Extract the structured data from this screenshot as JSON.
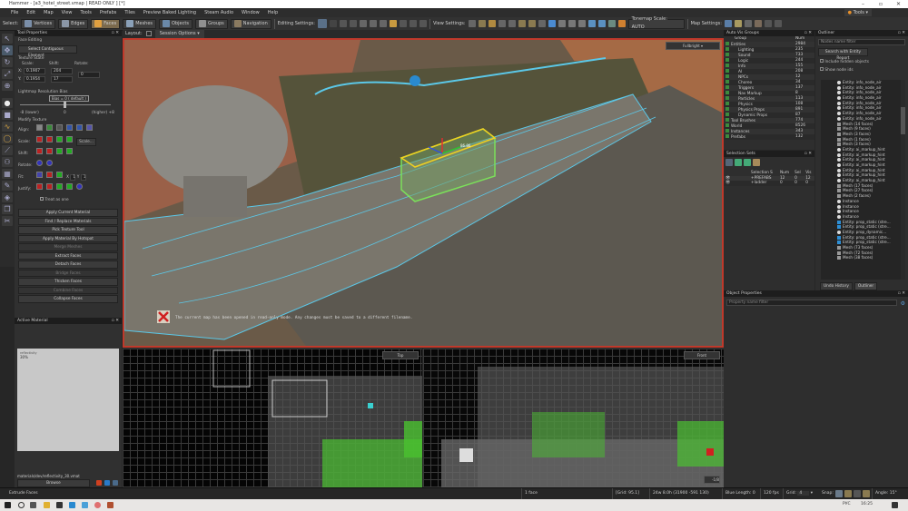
{
  "window": {
    "title": "Hammer - [a3_hotel_street.vmap | READ ONLY ] [*]"
  },
  "menu": [
    "File",
    "Edit",
    "Map",
    "View",
    "Tools",
    "Prefabs",
    "Tiles",
    "Preview Baked Lighting",
    "Steam Audio",
    "Window",
    "Help"
  ],
  "toolbar": {
    "select_label": "Select:",
    "modes": [
      "Vertices",
      "Edges",
      "Faces",
      "Meshes",
      "Objects",
      "Groups",
      "Navigation"
    ],
    "active_mode": "Faces",
    "editing_settings": "Editing Settings:",
    "view_settings": "View Settings:",
    "tonemap": "Tonemap Scale: AUTO",
    "map_settings": "Map Settings:",
    "tools": "Tools"
  },
  "tool_properties": {
    "title": "Tool Properties",
    "section": "Face Editing",
    "select_contiguous": "Select Contiguous Element",
    "texture_state": "Texture State",
    "scale_label": "Scale:",
    "shift_label": "Shift:",
    "rotate_label": "Rotate:",
    "x_label": "X:",
    "y_label": "Y:",
    "scale_x": "0.1907",
    "scale_y": "0.1954",
    "shift_x": "204",
    "shift_y": "17",
    "rotate": "0",
    "lightmap_bias": "Lightmap Resolution Bias",
    "bias_value": "Bias = 0 ( default )",
    "bias_low": "-8 (lower)",
    "bias_mid": "0",
    "bias_high": "(higher) +8",
    "modify_texture": "Modify Texture",
    "align": "Align:",
    "scale": "Scale:",
    "shift": "Shift:",
    "rotate_row": "Rotate:",
    "fit": "Fit:",
    "justify": "Justify:",
    "scale_btn": "Scale...",
    "fit_x": "X",
    "fit_x_val": "1",
    "fit_y": "Y",
    "fit_y_val": "1",
    "treat_as_one": "Treat as one",
    "buttons": [
      {
        "label": "Apply Current Material",
        "enabled": true
      },
      {
        "label": "Find / Replace Materials",
        "enabled": true
      },
      {
        "label": "Pick Texture Tool",
        "enabled": true
      },
      {
        "label": "Apply Material By Hotspot",
        "enabled": true
      },
      {
        "label": "Merge Meshes",
        "enabled": false
      },
      {
        "label": "Extract Faces",
        "enabled": true
      },
      {
        "label": "Detach Faces",
        "enabled": true
      },
      {
        "label": "Bridge Faces",
        "enabled": false
      },
      {
        "label": "Thicken Faces",
        "enabled": true
      },
      {
        "label": "Combine Faces",
        "enabled": false
      },
      {
        "label": "Collapse Faces",
        "enabled": true
      }
    ]
  },
  "active_material": {
    "title": "Active Material",
    "preview_caption": "reflectivity",
    "preview_value": "30%",
    "path": "materials/dev/reflectivity_30.vmat",
    "browse": "Browse"
  },
  "viewport": {
    "layout": "Layout:",
    "session_options": "Session Options",
    "view_3d": "Fullbright",
    "selection_label": "86.86",
    "readonly_msg": "The current map has been opened in read-only mode. Any changes must be saved to a different filename.",
    "view_top": "Top",
    "view_front": "Front",
    "front_corner": "-1/8"
  },
  "vis_groups": {
    "title": "Auto Vis Groups",
    "col_group": "Group",
    "col_num": "Num",
    "rows": [
      {
        "name": "Entities",
        "num": "2984",
        "indent": 0,
        "expand": "-"
      },
      {
        "name": "Lighting",
        "num": "235",
        "indent": 1
      },
      {
        "name": "Sound",
        "num": "733",
        "indent": 1
      },
      {
        "name": "Logic",
        "num": "244",
        "indent": 1
      },
      {
        "name": "Info",
        "num": "155",
        "indent": 1
      },
      {
        "name": "AI",
        "num": "208",
        "indent": 1
      },
      {
        "name": "NPCs",
        "num": "12",
        "indent": 1
      },
      {
        "name": "Choreo",
        "num": "34",
        "indent": 1
      },
      {
        "name": "Triggers",
        "num": "137",
        "indent": 1
      },
      {
        "name": "Nav Markup",
        "num": "8",
        "indent": 1
      },
      {
        "name": "Particles",
        "num": "113",
        "indent": 1
      },
      {
        "name": "Physics",
        "num": "108",
        "indent": 1
      },
      {
        "name": "Physics Props",
        "num": "891",
        "indent": 1
      },
      {
        "name": "Dynamic Props",
        "num": "87",
        "indent": 1
      },
      {
        "name": "Tool Brushes",
        "num": "774",
        "indent": 0,
        "expand": "+"
      },
      {
        "name": "World",
        "num": "8526",
        "indent": 0
      },
      {
        "name": "Instances",
        "num": "343",
        "indent": 0
      },
      {
        "name": "Prefabs",
        "num": "132",
        "indent": 0
      }
    ]
  },
  "selection_sets": {
    "title": "Selection Sets",
    "cols": [
      "Selection S",
      "Num",
      "Sel",
      "Vis"
    ],
    "rows": [
      {
        "name": "+PREFABS",
        "num": "12",
        "sel": "0",
        "vis": "12"
      },
      {
        "name": "+ladder",
        "num": "0",
        "sel": "0",
        "vis": "0"
      }
    ]
  },
  "outliner": {
    "title": "Outliner",
    "filter_placeholder": "Nodes name filter",
    "search_report": "Search with Entity Report",
    "include_hidden": "Include hidden objects",
    "show_node_ids": "Show node ids",
    "items": [
      {
        "t": "e",
        "l": "Entity: info_node_air"
      },
      {
        "t": "e",
        "l": "Entity: info_node_air"
      },
      {
        "t": "e",
        "l": "Entity: info_node_air"
      },
      {
        "t": "e",
        "l": "Entity: info_node_air"
      },
      {
        "t": "e",
        "l": "Entity: info_node_air"
      },
      {
        "t": "e",
        "l": "Entity: info_node_air"
      },
      {
        "t": "e",
        "l": "Entity: info_node_air"
      },
      {
        "t": "e",
        "l": "Entity: info_node_air"
      },
      {
        "t": "m",
        "l": "Mesh (14 faces)"
      },
      {
        "t": "m",
        "l": "Mesh (9 faces)"
      },
      {
        "t": "m",
        "l": "Mesh (3 faces)"
      },
      {
        "t": "m",
        "l": "Mesh (1 faces)"
      },
      {
        "t": "m",
        "l": "Mesh (3 faces)"
      },
      {
        "t": "e",
        "l": "Entity: ai_markup_hint"
      },
      {
        "t": "e",
        "l": "Entity: ai_markup_hint"
      },
      {
        "t": "e",
        "l": "Entity: ai_markup_hint"
      },
      {
        "t": "e",
        "l": "Entity: ai_markup_hint"
      },
      {
        "t": "e",
        "l": "Entity: ai_markup_hint"
      },
      {
        "t": "e",
        "l": "Entity: ai_markup_hint"
      },
      {
        "t": "e",
        "l": "Entity: ai_markup_hint"
      },
      {
        "t": "m",
        "l": "Mesh (17 faces)"
      },
      {
        "t": "m",
        "l": "Mesh (27 faces)"
      },
      {
        "t": "m",
        "l": "Mesh (2 faces)"
      },
      {
        "t": "e",
        "l": "Instance"
      },
      {
        "t": "e",
        "l": "Instance"
      },
      {
        "t": "e",
        "l": "Instance"
      },
      {
        "t": "e",
        "l": "Instance"
      },
      {
        "t": "p",
        "l": "Entity: prop_static (stre..."
      },
      {
        "t": "p",
        "l": "Entity: prop_static (stre..."
      },
      {
        "t": "e",
        "l": "Entity: prop_dynamic..."
      },
      {
        "t": "p",
        "l": "Entity: prop_static (stre..."
      },
      {
        "t": "p",
        "l": "Entity: prop_static (stre..."
      },
      {
        "t": "m",
        "l": "Mesh (73 faces)"
      },
      {
        "t": "m",
        "l": "Mesh (72 faces)"
      },
      {
        "t": "m",
        "l": "Mesh (38 faces)"
      }
    ],
    "tab_undo": "Undo History",
    "tab_outliner": "Outliner"
  },
  "object_properties": {
    "title": "Object Properties",
    "filter_placeholder": "Property name filter"
  },
  "status": {
    "tool": "Extrude Faces",
    "selection": "1 face",
    "grid_unit": "[Grid: 95.1]",
    "dims": "24w 8.0h (31900 -591 130)",
    "blue_length": "Blue Length: 0",
    "fps": "120 fps",
    "grid_label": "Grid:",
    "grid_value": "4",
    "snap_label": "Snap:",
    "angle_label": "Angle:",
    "angle_value": "15°"
  },
  "taskbar": {
    "lang": "РУС",
    "time": "16:25"
  }
}
